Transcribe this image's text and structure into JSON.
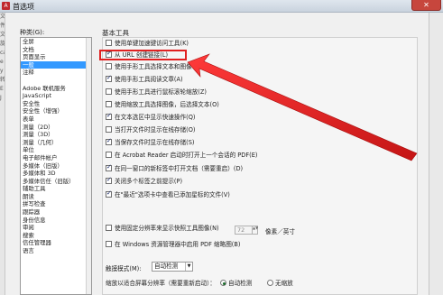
{
  "window": {
    "title": "首选项",
    "close_label": "✕",
    "app_icon_letter": "A"
  },
  "left_edge": [
    "文",
    "件",
    "文",
    "旋",
    "ca",
    "e",
    "y",
    "转",
    "E",
    "J"
  ],
  "categories": {
    "label": "种类(G):",
    "items": [
      "全屏",
      "文档",
      "页面显示",
      "一般",
      "注释",
      "",
      "Adobe 联机服务",
      "JavaScript",
      "安全性",
      "安全性（增强）",
      "表单",
      "测量（2D）",
      "测量（3D）",
      "测量（几何）",
      "单位",
      "电子邮件帐户",
      "多媒体（旧版）",
      "多媒体和 3D",
      "多媒体信任（旧版）",
      "辅助工具",
      "朗读",
      "拼写检查",
      "跟踪器",
      "身份信息",
      "审阅",
      "搜索",
      "信任管理器",
      "语言"
    ],
    "selected_index": 3
  },
  "section": {
    "title": "基本工具"
  },
  "options": [
    {
      "label": "使用单键加速键访问工具(K)",
      "checked": false,
      "disabled": false
    },
    {
      "label": "从 URL 创建链接(L)",
      "checked": true,
      "disabled": false
    },
    {
      "label": "使用手形工具选择文本和图像",
      "checked": false,
      "disabled": false
    },
    {
      "label": "使用手形工具阅读文章(A)",
      "checked": true,
      "disabled": false
    },
    {
      "label": "使用手形工具进行鼠标滚轮缩放(Z)",
      "checked": false,
      "disabled": false
    },
    {
      "label": "使用缩放工具选择图像，后选择文本(O)",
      "checked": false,
      "disabled": false
    },
    {
      "label": "在文本选区中显示快速操作(Q)",
      "checked": true,
      "disabled": false
    },
    {
      "label": "当打开文件时显示在线存储(O)",
      "checked": false,
      "disabled": false
    },
    {
      "label": "当保存文件时显示在线存储(S)",
      "checked": true,
      "disabled": false
    },
    {
      "label": "在 Acrobat Reader 启动时打开上一个会话的 PDF(E)",
      "checked": false,
      "disabled": false
    },
    {
      "label": "在同一窗口的新标签中打开文档（需要重启）(D)",
      "checked": true,
      "disabled": false
    },
    {
      "label": "关闭多个标签之前提示(P)",
      "checked": true,
      "disabled": false
    },
    {
      "label": "在\"最近\"选项卡中查看已添加星标的文件(V)",
      "checked": true,
      "disabled": false
    },
    {
      "label": "使用固定分辨率来显示快照工具图像(N)",
      "checked": false,
      "disabled": false
    },
    {
      "label": "在 Windows 资源管理器中启用 PDF 缩略图(B)",
      "checked": false,
      "disabled": false
    }
  ],
  "resolution": {
    "value": "72",
    "unit": "像素／英寸",
    "arrows": "▲▼"
  },
  "touch_mode": {
    "label": "触摸模式(M):",
    "value": "自动检测",
    "dropdown_glyph": "▼"
  },
  "scaling": {
    "label": "缩放以适合屏幕分辨率（需要重新启动）：",
    "auto_label": "自动检测",
    "none_label": "无缩放",
    "selected": "auto"
  },
  "colors": {
    "highlight": "#e02020",
    "selection": "#3399ff"
  }
}
